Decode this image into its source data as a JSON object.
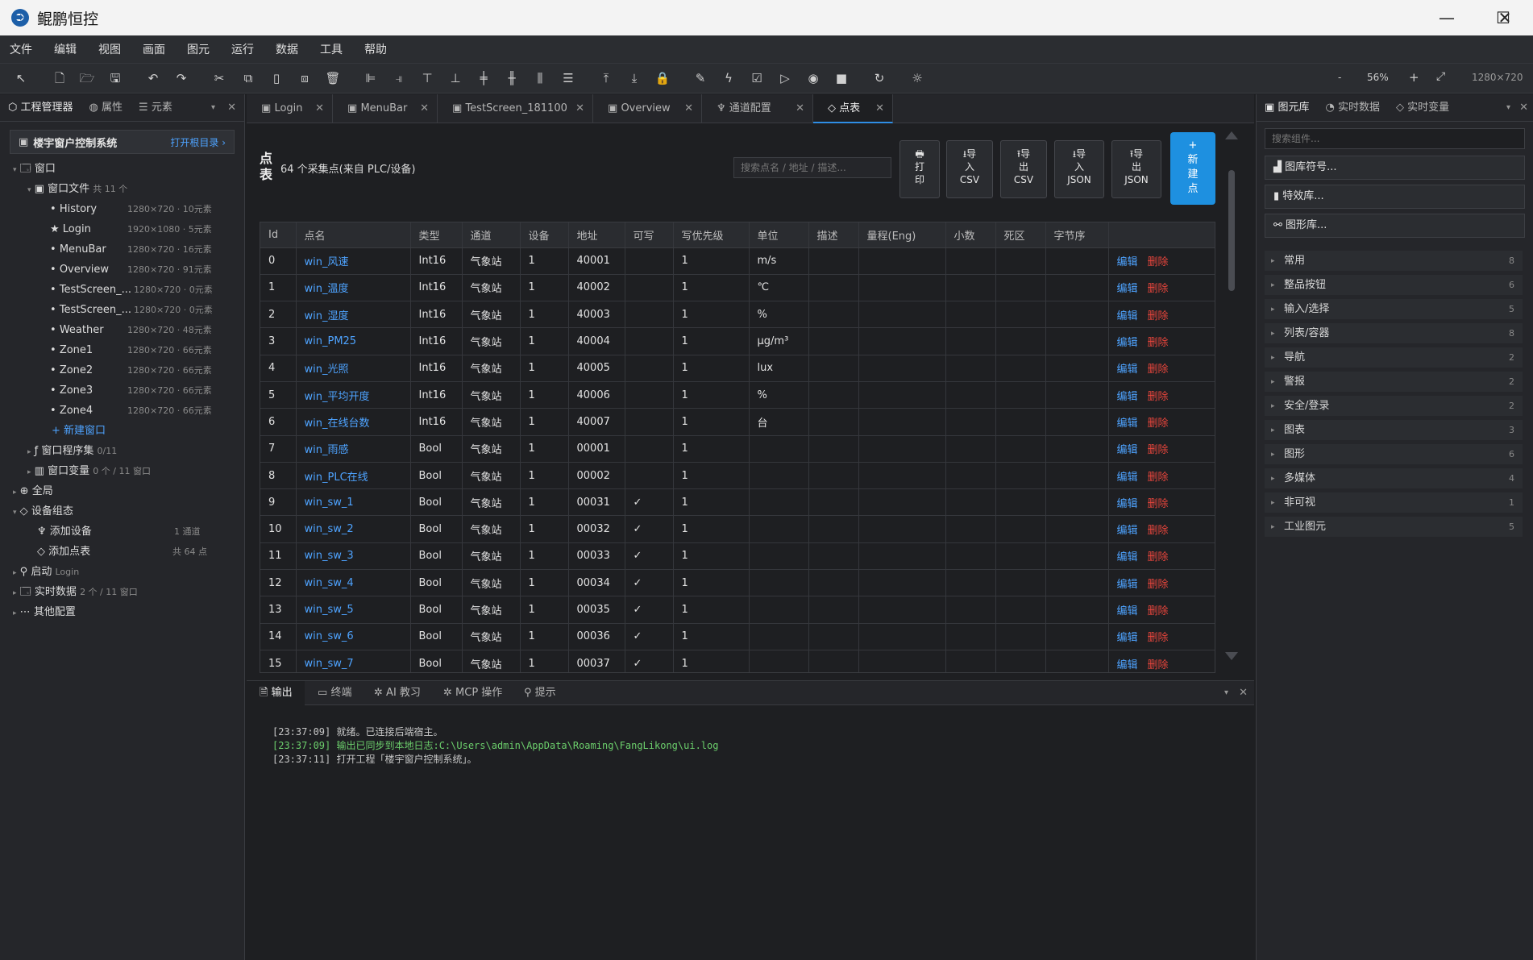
{
  "window": {
    "title": "鲲鹏恒控",
    "minimize": "—",
    "maximize": "☐",
    "close": "✕",
    "logo": "⮊"
  },
  "menu": [
    "文件",
    "编辑",
    "视图",
    "画面",
    "图元",
    "运行",
    "数据",
    "工具",
    "帮助"
  ],
  "toolbar": {
    "zoom": "56%",
    "zoom_minus": "-",
    "zoom_plus": "+",
    "fit": "⤢",
    "resolution": "1280×720",
    "icons": [
      "pointer-icon",
      "new-file-icon",
      "open-folder-icon",
      "save-icon",
      "undo-icon",
      "redo-icon",
      "cut-icon",
      "copy-icon",
      "paste-icon",
      "duplicate-icon",
      "delete-icon",
      "align-left-icon",
      "align-right-icon",
      "align-top-icon",
      "align-bottom-icon",
      "align-center-h-icon",
      "align-center-v-icon",
      "distribute-h-icon",
      "distribute-v-icon",
      "bring-front-icon",
      "send-back-icon",
      "lock-icon",
      "pen-icon",
      "lightning-icon",
      "checklist-icon",
      "play-icon",
      "preview-eye-icon",
      "stop-icon",
      "refresh-icon",
      "settings-sun-icon"
    ]
  },
  "left_panel": {
    "tabs": [
      {
        "label": "工程管理器",
        "icon": "⬡"
      },
      {
        "label": "属性",
        "icon": "◍"
      },
      {
        "label": "元素",
        "icon": "☰"
      }
    ],
    "project_name": "楼宇窗户控制系统",
    "open_dir": "打开根目录 ›",
    "tree": {
      "windows": "窗口",
      "window_files": "窗口文件",
      "window_files_count": "共 11 个",
      "screens": [
        {
          "name": "History",
          "meta": "1280×720 · 10元素",
          "star": false
        },
        {
          "name": "Login",
          "meta": "1920×1080 · 5元素",
          "star": true
        },
        {
          "name": "MenuBar",
          "meta": "1280×720 · 16元素",
          "star": false
        },
        {
          "name": "Overview",
          "meta": "1280×720 · 91元素",
          "star": false
        },
        {
          "name": "TestScreen_...",
          "meta": "1280×720 · 0元素",
          "star": false
        },
        {
          "name": "TestScreen_...",
          "meta": "1280×720 · 0元素",
          "star": false
        },
        {
          "name": "Weather",
          "meta": "1280×720 · 48元素",
          "star": false
        },
        {
          "name": "Zone1",
          "meta": "1280×720 · 66元素",
          "star": false
        },
        {
          "name": "Zone2",
          "meta": "1280×720 · 66元素",
          "star": false
        },
        {
          "name": "Zone3",
          "meta": "1280×720 · 66元素",
          "star": false
        },
        {
          "name": "Zone4",
          "meta": "1280×720 · 66元素",
          "star": false
        }
      ],
      "new_window": "+ 新建窗口",
      "window_programs": "窗口程序集",
      "window_programs_meta": "0/11",
      "window_vars": "窗口变量",
      "window_vars_meta": "0 个 / 11 窗口",
      "global": "全局",
      "device_config": "设备组态",
      "add_device": "添加设备",
      "add_device_meta": "1 通道",
      "add_points": "添加点表",
      "add_points_meta": "共 64 点",
      "startup": "启动",
      "startup_meta": "Login",
      "realtime_data": "实时数据",
      "realtime_data_meta": "2 个 / 11 窗口",
      "other_config": "其他配置"
    }
  },
  "doc_tabs": [
    {
      "label": "Login",
      "icon": "▣"
    },
    {
      "label": "MenuBar",
      "icon": "▣"
    },
    {
      "label": "TestScreen_181100",
      "icon": "▣"
    },
    {
      "label": "Overview",
      "icon": "▣"
    },
    {
      "label": "通道配置",
      "icon": "♆"
    },
    {
      "label": "点表",
      "icon": "◇",
      "active": true
    }
  ],
  "points_page": {
    "title": "点表",
    "subtitle": "64 个采集点(来自 PLC/设备)",
    "search_placeholder": "搜索点名 / 地址 / 描述...",
    "buttons": [
      "🖶\n打\n印",
      "⭳导\n入\nCSV",
      "⭱导\n出\nCSV",
      "⭳导\n入\nJSON",
      "⭱导\n出\nJSON"
    ],
    "new_point": "+\n新\n建\n点",
    "columns": [
      "Id",
      "点名",
      "类型",
      "通道",
      "设备",
      "地址",
      "可写",
      "写优先级",
      "单位",
      "描述",
      "量程(Eng)",
      "小数",
      "死区",
      "字节序",
      ""
    ],
    "edit_label": "编辑",
    "delete_label": "删除",
    "rows": [
      {
        "id": "0",
        "name": "win_风速",
        "type": "Int16",
        "channel": "气象站",
        "device": "1",
        "addr": "40001",
        "writable": "",
        "prio": "1",
        "unit": "m/s"
      },
      {
        "id": "1",
        "name": "win_温度",
        "type": "Int16",
        "channel": "气象站",
        "device": "1",
        "addr": "40002",
        "writable": "",
        "prio": "1",
        "unit": "℃"
      },
      {
        "id": "2",
        "name": "win_湿度",
        "type": "Int16",
        "channel": "气象站",
        "device": "1",
        "addr": "40003",
        "writable": "",
        "prio": "1",
        "unit": "%"
      },
      {
        "id": "3",
        "name": "win_PM25",
        "type": "Int16",
        "channel": "气象站",
        "device": "1",
        "addr": "40004",
        "writable": "",
        "prio": "1",
        "unit": "μg/m³"
      },
      {
        "id": "4",
        "name": "win_光照",
        "type": "Int16",
        "channel": "气象站",
        "device": "1",
        "addr": "40005",
        "writable": "",
        "prio": "1",
        "unit": "lux"
      },
      {
        "id": "5",
        "name": "win_平均开度",
        "type": "Int16",
        "channel": "气象站",
        "device": "1",
        "addr": "40006",
        "writable": "",
        "prio": "1",
        "unit": "%"
      },
      {
        "id": "6",
        "name": "win_在线台数",
        "type": "Int16",
        "channel": "气象站",
        "device": "1",
        "addr": "40007",
        "writable": "",
        "prio": "1",
        "unit": "台"
      },
      {
        "id": "7",
        "name": "win_雨感",
        "type": "Bool",
        "channel": "气象站",
        "device": "1",
        "addr": "00001",
        "writable": "",
        "prio": "1",
        "unit": ""
      },
      {
        "id": "8",
        "name": "win_PLC在线",
        "type": "Bool",
        "channel": "气象站",
        "device": "1",
        "addr": "00002",
        "writable": "",
        "prio": "1",
        "unit": ""
      },
      {
        "id": "9",
        "name": "win_sw_1",
        "type": "Bool",
        "channel": "气象站",
        "device": "1",
        "addr": "00031",
        "writable": "✓",
        "prio": "1",
        "unit": ""
      },
      {
        "id": "10",
        "name": "win_sw_2",
        "type": "Bool",
        "channel": "气象站",
        "device": "1",
        "addr": "00032",
        "writable": "✓",
        "prio": "1",
        "unit": ""
      },
      {
        "id": "11",
        "name": "win_sw_3",
        "type": "Bool",
        "channel": "气象站",
        "device": "1",
        "addr": "00033",
        "writable": "✓",
        "prio": "1",
        "unit": ""
      },
      {
        "id": "12",
        "name": "win_sw_4",
        "type": "Bool",
        "channel": "气象站",
        "device": "1",
        "addr": "00034",
        "writable": "✓",
        "prio": "1",
        "unit": ""
      },
      {
        "id": "13",
        "name": "win_sw_5",
        "type": "Bool",
        "channel": "气象站",
        "device": "1",
        "addr": "00035",
        "writable": "✓",
        "prio": "1",
        "unit": ""
      },
      {
        "id": "14",
        "name": "win_sw_6",
        "type": "Bool",
        "channel": "气象站",
        "device": "1",
        "addr": "00036",
        "writable": "✓",
        "prio": "1",
        "unit": ""
      },
      {
        "id": "15",
        "name": "win_sw_7",
        "type": "Bool",
        "channel": "气象站",
        "device": "1",
        "addr": "00037",
        "writable": "✓",
        "prio": "1",
        "unit": ""
      }
    ]
  },
  "bottom_panel": {
    "tabs": [
      {
        "label": "输出",
        "icon": "🗎"
      },
      {
        "label": "终端",
        "icon": "▭"
      },
      {
        "label": "AI 教习",
        "icon": "✲"
      },
      {
        "label": "MCP 操作",
        "icon": "✲"
      },
      {
        "label": "提示",
        "icon": "⚲"
      }
    ],
    "logs": [
      {
        "text": "[23:37:09] 就绪。已连接后端宿主。",
        "green": false
      },
      {
        "text": "[23:37:09] 输出已同步到本地日志:C:\\Users\\admin\\AppData\\Roaming\\FangLikong\\ui.log",
        "green": true
      },
      {
        "text": "[23:37:11] 打开工程「楼宇窗户控制系统」。",
        "green": false
      }
    ]
  },
  "right_panel": {
    "tabs": [
      {
        "label": "图元库",
        "icon": "▣"
      },
      {
        "label": "实时数据",
        "icon": "◔"
      },
      {
        "label": "实时变量",
        "icon": "◇"
      }
    ],
    "search_placeholder": "搜索组件...",
    "buttons": [
      {
        "label": "图库符号...",
        "icon": "▟"
      },
      {
        "label": "特效库...",
        "icon": "▮"
      },
      {
        "label": "图形库...",
        "icon": "⚯"
      }
    ],
    "categories": [
      {
        "name": "常用",
        "count": "8"
      },
      {
        "name": "整品按钮",
        "count": "6"
      },
      {
        "name": "输入/选择",
        "count": "5"
      },
      {
        "name": "列表/容器",
        "count": "8"
      },
      {
        "name": "导航",
        "count": "2"
      },
      {
        "name": "警报",
        "count": "2"
      },
      {
        "name": "安全/登录",
        "count": "2"
      },
      {
        "name": "图表",
        "count": "3"
      },
      {
        "name": "图形",
        "count": "6"
      },
      {
        "name": "多媒体",
        "count": "4"
      },
      {
        "name": "非可视",
        "count": "1"
      },
      {
        "name": "工业图元",
        "count": "5"
      }
    ]
  },
  "colors": {
    "accent": "#1e90e0",
    "link": "#4ea3ff",
    "danger": "#e8453c",
    "bg": "#1e1f22"
  }
}
